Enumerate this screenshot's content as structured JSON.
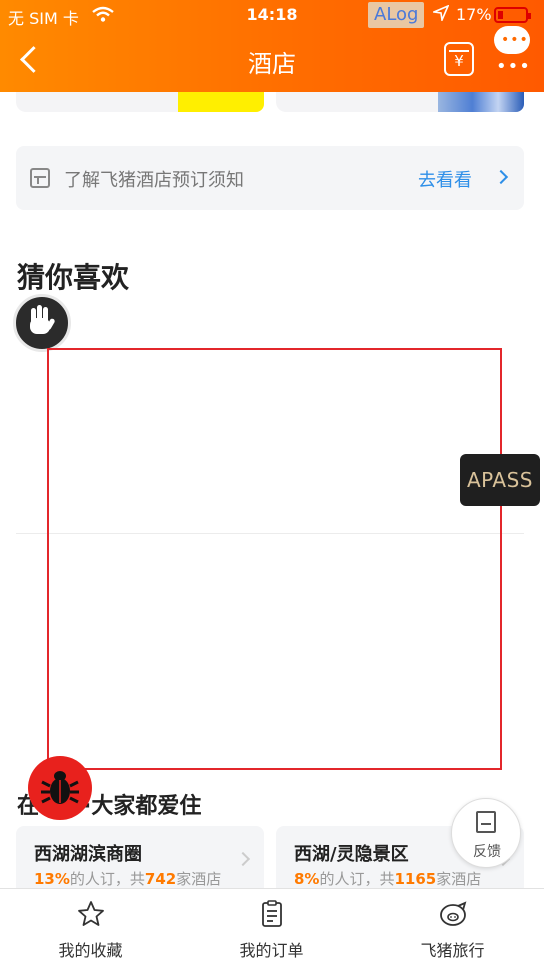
{
  "status_bar": {
    "carrier": "无 SIM 卡",
    "time": "14:18",
    "alog": "ALog",
    "battery": "17%",
    "battery_level": 0.17
  },
  "nav": {
    "title": "酒店",
    "yen_symbol": "¥"
  },
  "notice": {
    "text": "了解飞猪酒店预订须知",
    "link": "去看看"
  },
  "recommend": {
    "title": "猜你喜欢"
  },
  "apass": {
    "label": "APASS"
  },
  "popular": {
    "title": "在杭州·大家都爱住",
    "title_visible_prefix": "在",
    "title_visible_suffix": "·大家都爱住",
    "areas": [
      {
        "name": "西湖湖滨商圈",
        "pct": "13%",
        "mid": "的人订，共",
        "count": "742",
        "suffix": "家酒店"
      },
      {
        "name": "西湖/灵隐景区",
        "pct": "8%",
        "mid": "的人订，共",
        "count": "1165",
        "suffix": "家酒店"
      }
    ]
  },
  "feedback": {
    "label": "反馈"
  },
  "tabbar": {
    "items": [
      {
        "label": "我的收藏",
        "icon": "star-icon"
      },
      {
        "label": "我的订单",
        "icon": "order-icon"
      },
      {
        "label": "飞猪旅行",
        "icon": "pig-icon"
      }
    ]
  },
  "colors": {
    "header_start": "#ff8a00",
    "header_end": "#ff5a00",
    "link_blue": "#2e8fe8",
    "highlight_orange": "#ff7a00",
    "selection_red": "#e3262b"
  }
}
